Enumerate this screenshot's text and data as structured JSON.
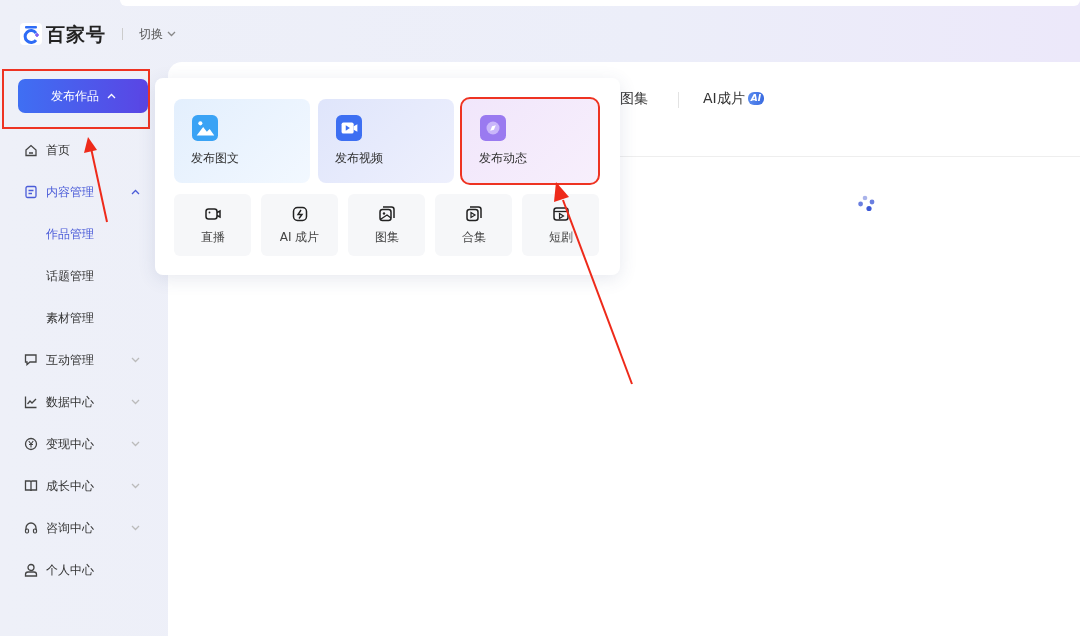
{
  "header": {
    "logo_text": "百家号",
    "switch_label": "切换"
  },
  "publish_button": {
    "label": "发布作品",
    "expanded": true,
    "highlighted": true
  },
  "sidebar": {
    "items": [
      {
        "kind": "link",
        "label": "首页",
        "selected": false
      },
      {
        "kind": "group",
        "label": "内容管理",
        "selected": true,
        "expanded": true,
        "children": [
          {
            "label": "作品管理",
            "selected": true
          },
          {
            "label": "话题管理",
            "selected": false
          },
          {
            "label": "素材管理",
            "selected": false
          }
        ]
      },
      {
        "kind": "group",
        "label": "互动管理",
        "selected": false,
        "expanded": false
      },
      {
        "kind": "group",
        "label": "数据中心",
        "selected": false,
        "expanded": false
      },
      {
        "kind": "group",
        "label": "变现中心",
        "selected": false,
        "expanded": false
      },
      {
        "kind": "group",
        "label": "成长中心",
        "selected": false,
        "expanded": false
      },
      {
        "kind": "group",
        "label": "咨询中心",
        "selected": false,
        "expanded": false
      },
      {
        "kind": "link",
        "label": "个人中心",
        "selected": false
      }
    ]
  },
  "tabs": [
    {
      "label": "图集"
    },
    {
      "label": "AI成片",
      "badge": "AI"
    }
  ],
  "publish_menu": {
    "main_options": [
      {
        "kind": "image",
        "label": "发布图文",
        "highlighted": false
      },
      {
        "kind": "video",
        "label": "发布视频",
        "highlighted": false
      },
      {
        "kind": "moment",
        "label": "发布动态",
        "highlighted": true
      }
    ],
    "tiles": [
      {
        "kind": "live",
        "label": "直播"
      },
      {
        "kind": "ai",
        "label": "AI 成片"
      },
      {
        "kind": "album",
        "label": "图集"
      },
      {
        "kind": "collection",
        "label": "合集"
      },
      {
        "kind": "drama",
        "label": "短剧"
      }
    ]
  }
}
